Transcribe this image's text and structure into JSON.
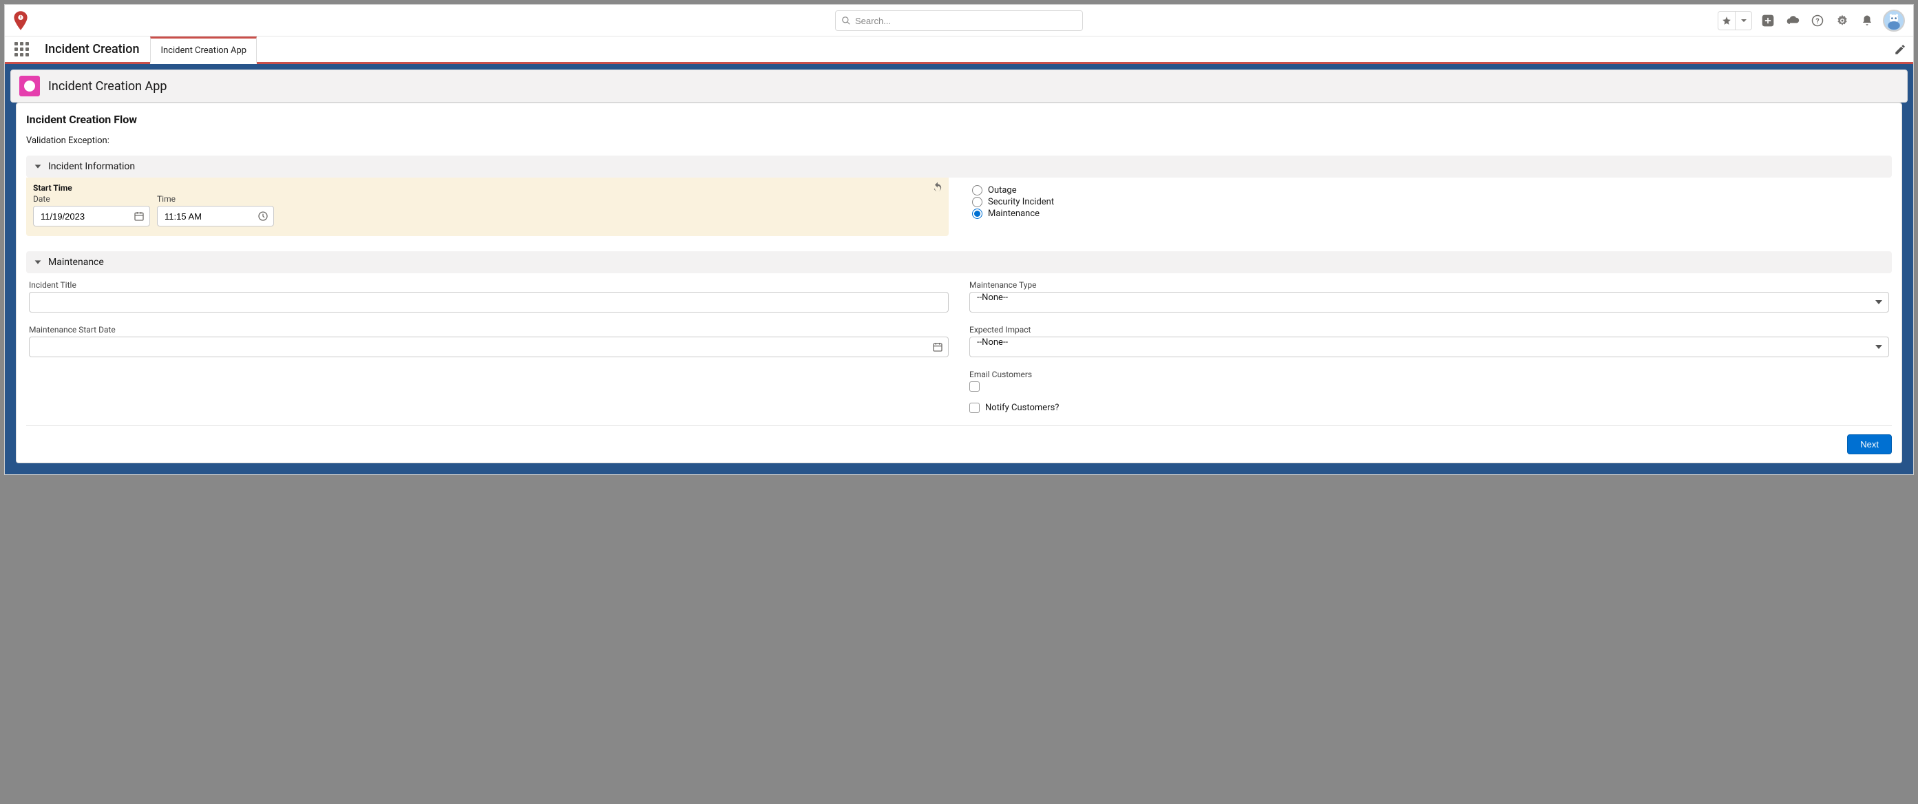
{
  "header": {
    "search_placeholder": "Search..."
  },
  "nav": {
    "app_title": "Incident Creation",
    "tabs": [
      {
        "label": "Incident Creation App",
        "active": true
      }
    ]
  },
  "page_header": {
    "title": "Incident Creation App"
  },
  "flow": {
    "title": "Incident Creation Flow",
    "validation_label": "Validation Exception:",
    "section_incident_info": "Incident Information",
    "start_time": {
      "group_label": "Start Time",
      "date_label": "Date",
      "date_value": "11/19/2023",
      "time_label": "Time",
      "time_value": "11:15 AM"
    },
    "incident_type_options": [
      {
        "label": "Outage",
        "checked": false
      },
      {
        "label": "Security Incident",
        "checked": false
      },
      {
        "label": "Maintenance",
        "checked": true
      }
    ],
    "section_maintenance": "Maintenance",
    "maintenance": {
      "incident_title_label": "Incident Title",
      "incident_title_value": "",
      "maint_type_label": "Maintenance Type",
      "maint_type_value": "--None--",
      "maint_start_date_label": "Maintenance Start Date",
      "maint_start_date_value": "",
      "expected_impact_label": "Expected Impact",
      "expected_impact_value": "--None--",
      "email_customers_label": "Email Customers",
      "notify_customers_label": "Notify Customers?"
    },
    "next_button": "Next"
  }
}
